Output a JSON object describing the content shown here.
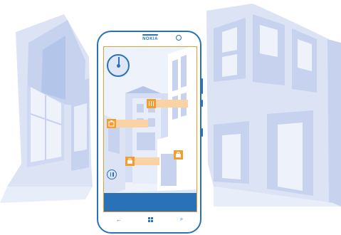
{
  "phone": {
    "brand": "NOKIA"
  },
  "app": {
    "pois": [
      {
        "icon": "shopping-icon"
      },
      {
        "icon": "shopping-icon"
      },
      {
        "icon": "lodging-icon"
      },
      {
        "icon": "restaurant-icon"
      }
    ]
  },
  "navbar": {
    "back_icon": "←",
    "search_icon": "⌕"
  },
  "colors": {
    "accent": "#2a72b8",
    "poi_icon": "#f39d31",
    "poi_label": "#fbd2a3",
    "scene": "#dfe7f6"
  }
}
